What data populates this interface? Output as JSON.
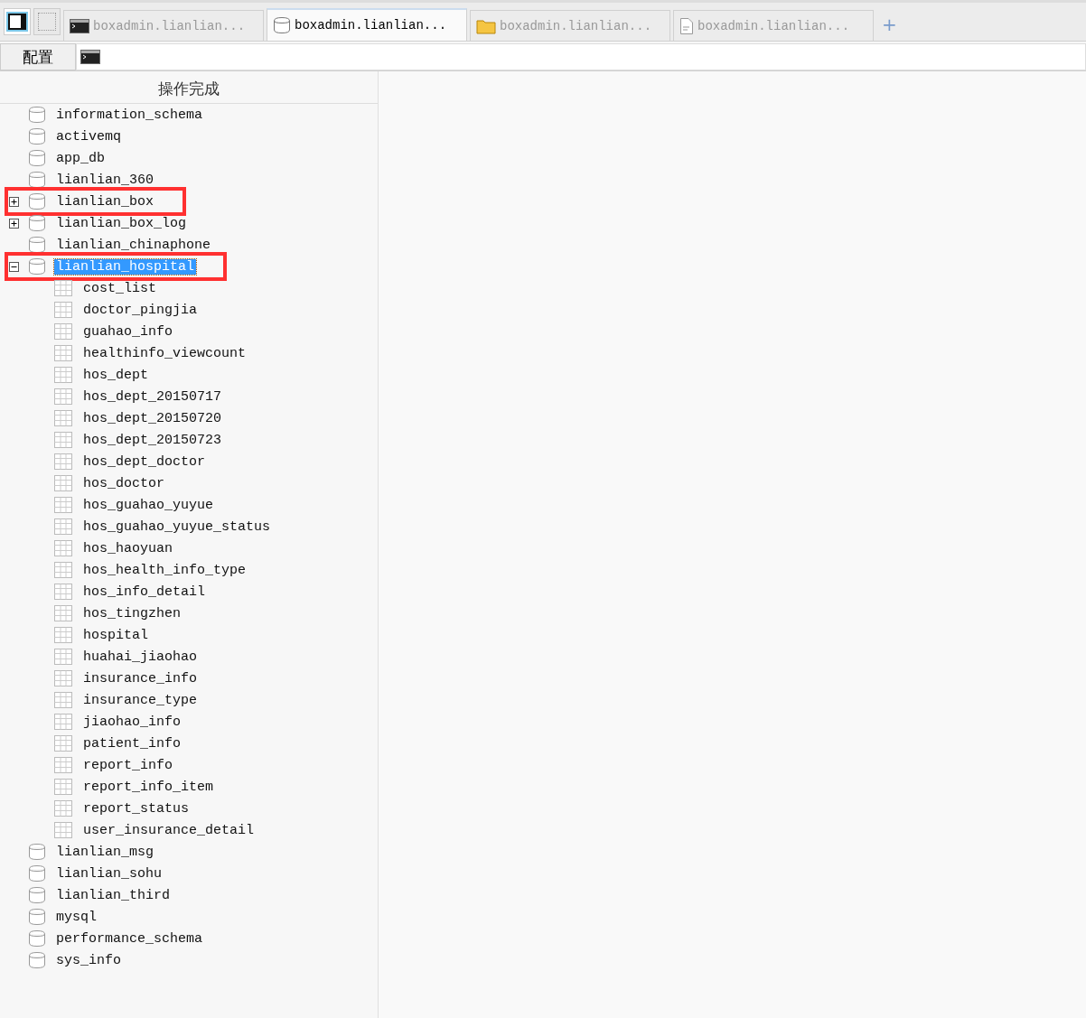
{
  "tabs": [
    {
      "label": "boxadmin.lianlian...",
      "kind": "terminal",
      "selected": false
    },
    {
      "label": "boxadmin.lianlian...",
      "kind": "database",
      "selected": true
    },
    {
      "label": "boxadmin.lianlian...",
      "kind": "folder",
      "selected": false
    },
    {
      "label": "boxadmin.lianlian...",
      "kind": "document",
      "selected": false
    }
  ],
  "new_tab": "+",
  "toolbar": {
    "config_button": "配置"
  },
  "status": "操作完成",
  "tree": [
    {
      "label": "information_schema",
      "selected": false,
      "highlighted": false
    },
    {
      "label": "activemq",
      "selected": false,
      "highlighted": false
    },
    {
      "label": "app_db",
      "selected": false,
      "highlighted": false
    },
    {
      "label": "lianlian_360",
      "selected": false,
      "highlighted": false
    },
    {
      "label": "lianlian_box",
      "selected": false,
      "highlighted": true,
      "expanded": false
    },
    {
      "label": "lianlian_box_log",
      "selected": false,
      "highlighted": false,
      "expanded": false
    },
    {
      "label": "lianlian_chinaphone",
      "selected": false,
      "highlighted": false
    },
    {
      "label": "lianlian_hospital",
      "selected": true,
      "highlighted": true,
      "expanded": true,
      "children": [
        {
          "label": "cost_list"
        },
        {
          "label": "doctor_pingjia"
        },
        {
          "label": "guahao_info"
        },
        {
          "label": "healthinfo_viewcount"
        },
        {
          "label": "hos_dept"
        },
        {
          "label": "hos_dept_20150717"
        },
        {
          "label": "hos_dept_20150720"
        },
        {
          "label": "hos_dept_20150723"
        },
        {
          "label": "hos_dept_doctor"
        },
        {
          "label": "hos_doctor"
        },
        {
          "label": "hos_guahao_yuyue"
        },
        {
          "label": "hos_guahao_yuyue_status"
        },
        {
          "label": "hos_haoyuan"
        },
        {
          "label": "hos_health_info_type"
        },
        {
          "label": "hos_info_detail"
        },
        {
          "label": "hos_tingzhen"
        },
        {
          "label": "hospital"
        },
        {
          "label": "huahai_jiaohao"
        },
        {
          "label": "insurance_info"
        },
        {
          "label": "insurance_type"
        },
        {
          "label": "jiaohao_info"
        },
        {
          "label": "patient_info"
        },
        {
          "label": "report_info"
        },
        {
          "label": "report_info_item"
        },
        {
          "label": "report_status"
        },
        {
          "label": "user_insurance_detail"
        }
      ]
    },
    {
      "label": "lianlian_msg",
      "selected": false,
      "highlighted": false
    },
    {
      "label": "lianlian_sohu",
      "selected": false,
      "highlighted": false
    },
    {
      "label": "lianlian_third",
      "selected": false,
      "highlighted": false
    },
    {
      "label": "mysql",
      "selected": false,
      "highlighted": false
    },
    {
      "label": "performance_schema",
      "selected": false,
      "highlighted": false
    },
    {
      "label": "sys_info",
      "selected": false,
      "highlighted": false
    }
  ]
}
